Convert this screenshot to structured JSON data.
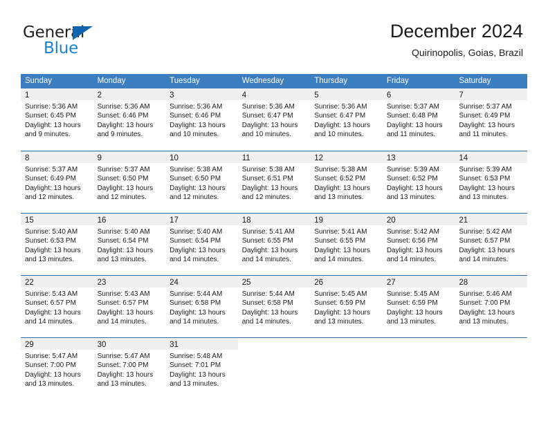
{
  "brand": {
    "word_one": "General",
    "word_two": "Blue",
    "triangle_color": "#1264ad",
    "blue_color": "#1b82d2"
  },
  "header": {
    "title": "December 2024",
    "location": "Quirinopolis, Goias, Brazil"
  },
  "theme": {
    "header_row_bg": "#3b7dbf",
    "row_divider": "#2e6da4",
    "day_band_bg": "#f0f0f0",
    "text": "#1a1a1a"
  },
  "weekdays": [
    "Sunday",
    "Monday",
    "Tuesday",
    "Wednesday",
    "Thursday",
    "Friday",
    "Saturday"
  ],
  "labels": {
    "sunrise_prefix": "Sunrise:",
    "sunset_prefix": "Sunset:",
    "daylight_prefix": "Daylight:"
  },
  "weeks": [
    [
      {
        "day": "1",
        "sunrise": "Sunrise: 5:36 AM",
        "sunset": "Sunset: 6:45 PM",
        "daylight_line1": "Daylight: 13 hours",
        "daylight_line2": "and 9 minutes."
      },
      {
        "day": "2",
        "sunrise": "Sunrise: 5:36 AM",
        "sunset": "Sunset: 6:46 PM",
        "daylight_line1": "Daylight: 13 hours",
        "daylight_line2": "and 9 minutes."
      },
      {
        "day": "3",
        "sunrise": "Sunrise: 5:36 AM",
        "sunset": "Sunset: 6:46 PM",
        "daylight_line1": "Daylight: 13 hours",
        "daylight_line2": "and 10 minutes."
      },
      {
        "day": "4",
        "sunrise": "Sunrise: 5:36 AM",
        "sunset": "Sunset: 6:47 PM",
        "daylight_line1": "Daylight: 13 hours",
        "daylight_line2": "and 10 minutes."
      },
      {
        "day": "5",
        "sunrise": "Sunrise: 5:36 AM",
        "sunset": "Sunset: 6:47 PM",
        "daylight_line1": "Daylight: 13 hours",
        "daylight_line2": "and 10 minutes."
      },
      {
        "day": "6",
        "sunrise": "Sunrise: 5:37 AM",
        "sunset": "Sunset: 6:48 PM",
        "daylight_line1": "Daylight: 13 hours",
        "daylight_line2": "and 11 minutes."
      },
      {
        "day": "7",
        "sunrise": "Sunrise: 5:37 AM",
        "sunset": "Sunset: 6:49 PM",
        "daylight_line1": "Daylight: 13 hours",
        "daylight_line2": "and 11 minutes."
      }
    ],
    [
      {
        "day": "8",
        "sunrise": "Sunrise: 5:37 AM",
        "sunset": "Sunset: 6:49 PM",
        "daylight_line1": "Daylight: 13 hours",
        "daylight_line2": "and 12 minutes."
      },
      {
        "day": "9",
        "sunrise": "Sunrise: 5:37 AM",
        "sunset": "Sunset: 6:50 PM",
        "daylight_line1": "Daylight: 13 hours",
        "daylight_line2": "and 12 minutes."
      },
      {
        "day": "10",
        "sunrise": "Sunrise: 5:38 AM",
        "sunset": "Sunset: 6:50 PM",
        "daylight_line1": "Daylight: 13 hours",
        "daylight_line2": "and 12 minutes."
      },
      {
        "day": "11",
        "sunrise": "Sunrise: 5:38 AM",
        "sunset": "Sunset: 6:51 PM",
        "daylight_line1": "Daylight: 13 hours",
        "daylight_line2": "and 12 minutes."
      },
      {
        "day": "12",
        "sunrise": "Sunrise: 5:38 AM",
        "sunset": "Sunset: 6:52 PM",
        "daylight_line1": "Daylight: 13 hours",
        "daylight_line2": "and 13 minutes."
      },
      {
        "day": "13",
        "sunrise": "Sunrise: 5:39 AM",
        "sunset": "Sunset: 6:52 PM",
        "daylight_line1": "Daylight: 13 hours",
        "daylight_line2": "and 13 minutes."
      },
      {
        "day": "14",
        "sunrise": "Sunrise: 5:39 AM",
        "sunset": "Sunset: 6:53 PM",
        "daylight_line1": "Daylight: 13 hours",
        "daylight_line2": "and 13 minutes."
      }
    ],
    [
      {
        "day": "15",
        "sunrise": "Sunrise: 5:40 AM",
        "sunset": "Sunset: 6:53 PM",
        "daylight_line1": "Daylight: 13 hours",
        "daylight_line2": "and 13 minutes."
      },
      {
        "day": "16",
        "sunrise": "Sunrise: 5:40 AM",
        "sunset": "Sunset: 6:54 PM",
        "daylight_line1": "Daylight: 13 hours",
        "daylight_line2": "and 13 minutes."
      },
      {
        "day": "17",
        "sunrise": "Sunrise: 5:40 AM",
        "sunset": "Sunset: 6:54 PM",
        "daylight_line1": "Daylight: 13 hours",
        "daylight_line2": "and 14 minutes."
      },
      {
        "day": "18",
        "sunrise": "Sunrise: 5:41 AM",
        "sunset": "Sunset: 6:55 PM",
        "daylight_line1": "Daylight: 13 hours",
        "daylight_line2": "and 14 minutes."
      },
      {
        "day": "19",
        "sunrise": "Sunrise: 5:41 AM",
        "sunset": "Sunset: 6:55 PM",
        "daylight_line1": "Daylight: 13 hours",
        "daylight_line2": "and 14 minutes."
      },
      {
        "day": "20",
        "sunrise": "Sunrise: 5:42 AM",
        "sunset": "Sunset: 6:56 PM",
        "daylight_line1": "Daylight: 13 hours",
        "daylight_line2": "and 14 minutes."
      },
      {
        "day": "21",
        "sunrise": "Sunrise: 5:42 AM",
        "sunset": "Sunset: 6:57 PM",
        "daylight_line1": "Daylight: 13 hours",
        "daylight_line2": "and 14 minutes."
      }
    ],
    [
      {
        "day": "22",
        "sunrise": "Sunrise: 5:43 AM",
        "sunset": "Sunset: 6:57 PM",
        "daylight_line1": "Daylight: 13 hours",
        "daylight_line2": "and 14 minutes."
      },
      {
        "day": "23",
        "sunrise": "Sunrise: 5:43 AM",
        "sunset": "Sunset: 6:57 PM",
        "daylight_line1": "Daylight: 13 hours",
        "daylight_line2": "and 14 minutes."
      },
      {
        "day": "24",
        "sunrise": "Sunrise: 5:44 AM",
        "sunset": "Sunset: 6:58 PM",
        "daylight_line1": "Daylight: 13 hours",
        "daylight_line2": "and 14 minutes."
      },
      {
        "day": "25",
        "sunrise": "Sunrise: 5:44 AM",
        "sunset": "Sunset: 6:58 PM",
        "daylight_line1": "Daylight: 13 hours",
        "daylight_line2": "and 14 minutes."
      },
      {
        "day": "26",
        "sunrise": "Sunrise: 5:45 AM",
        "sunset": "Sunset: 6:59 PM",
        "daylight_line1": "Daylight: 13 hours",
        "daylight_line2": "and 13 minutes."
      },
      {
        "day": "27",
        "sunrise": "Sunrise: 5:45 AM",
        "sunset": "Sunset: 6:59 PM",
        "daylight_line1": "Daylight: 13 hours",
        "daylight_line2": "and 13 minutes."
      },
      {
        "day": "28",
        "sunrise": "Sunrise: 5:46 AM",
        "sunset": "Sunset: 7:00 PM",
        "daylight_line1": "Daylight: 13 hours",
        "daylight_line2": "and 13 minutes."
      }
    ],
    [
      {
        "day": "29",
        "sunrise": "Sunrise: 5:47 AM",
        "sunset": "Sunset: 7:00 PM",
        "daylight_line1": "Daylight: 13 hours",
        "daylight_line2": "and 13 minutes."
      },
      {
        "day": "30",
        "sunrise": "Sunrise: 5:47 AM",
        "sunset": "Sunset: 7:00 PM",
        "daylight_line1": "Daylight: 13 hours",
        "daylight_line2": "and 13 minutes."
      },
      {
        "day": "31",
        "sunrise": "Sunrise: 5:48 AM",
        "sunset": "Sunset: 7:01 PM",
        "daylight_line1": "Daylight: 13 hours",
        "daylight_line2": "and 13 minutes."
      },
      {
        "day": "",
        "sunrise": "",
        "sunset": "",
        "daylight_line1": "",
        "daylight_line2": ""
      },
      {
        "day": "",
        "sunrise": "",
        "sunset": "",
        "daylight_line1": "",
        "daylight_line2": ""
      },
      {
        "day": "",
        "sunrise": "",
        "sunset": "",
        "daylight_line1": "",
        "daylight_line2": ""
      },
      {
        "day": "",
        "sunrise": "",
        "sunset": "",
        "daylight_line1": "",
        "daylight_line2": ""
      }
    ]
  ]
}
